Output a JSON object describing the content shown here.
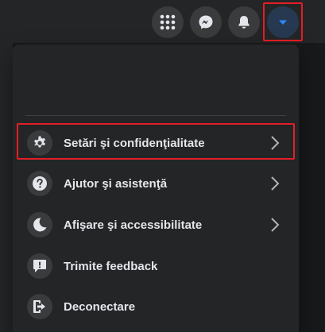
{
  "topbar": {
    "buttons": [
      {
        "icon": "grid-menu-icon"
      },
      {
        "icon": "messenger-icon"
      },
      {
        "icon": "bell-icon"
      },
      {
        "icon": "caret-down-icon"
      }
    ]
  },
  "menu": {
    "items": [
      {
        "label": "Setări şi confidenţialitate",
        "icon": "gear-icon",
        "has_chevron": true
      },
      {
        "label": "Ajutor şi asistenţă",
        "icon": "question-icon",
        "has_chevron": true
      },
      {
        "label": "Afişare şi accessibilitate",
        "icon": "moon-icon",
        "has_chevron": true
      },
      {
        "label": "Trimite feedback",
        "icon": "feedback-icon",
        "has_chevron": false
      },
      {
        "label": "Deconectare",
        "icon": "logout-icon",
        "has_chevron": false
      }
    ]
  },
  "colors": {
    "highlight_frame": "#e41e26",
    "account_accent": "#2d88ff",
    "text": "#e4e6eb",
    "panel": "#242526"
  }
}
